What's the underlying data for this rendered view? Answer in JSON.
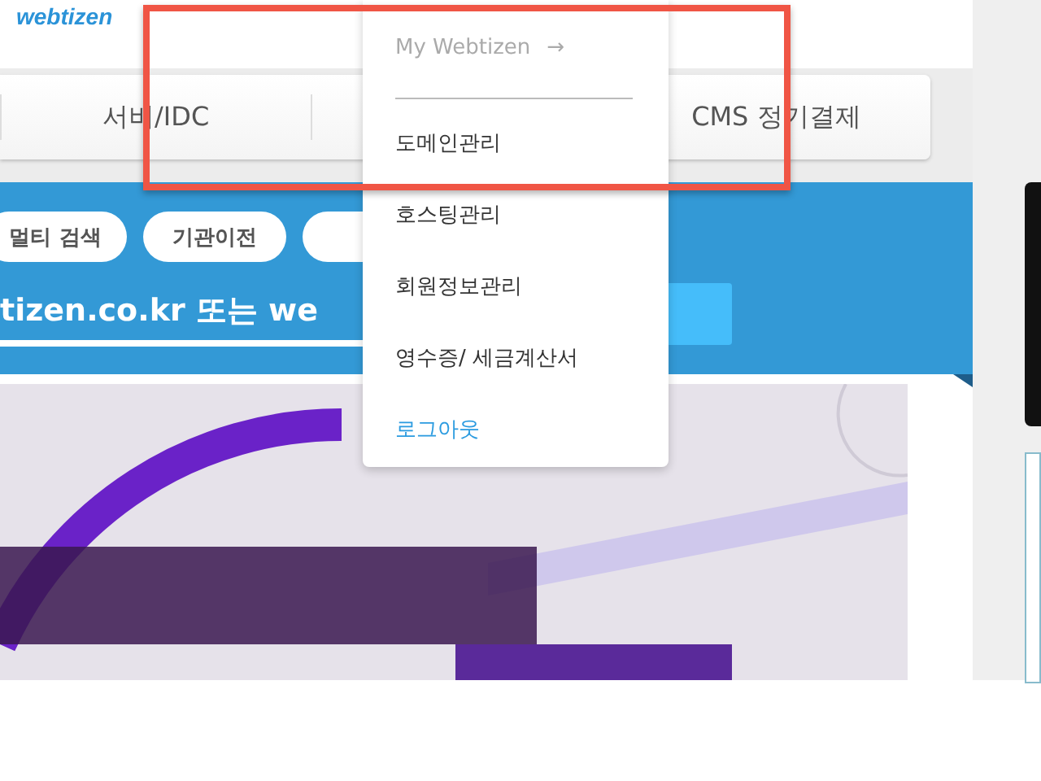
{
  "logo": "webtizen",
  "nav": {
    "items": [
      {
        "label": "서버/IDC"
      },
      {
        "label": "CMS 정기결제"
      }
    ]
  },
  "search_panel": {
    "quick_buttons": [
      "멀티 검색",
      "기관이전"
    ],
    "query_hint": "tizen.co.kr 또는 we"
  },
  "dropdown": {
    "header": "My Webtizen",
    "header_icon": "→",
    "items": [
      {
        "label": "도메인관리",
        "kind": "normal"
      },
      {
        "label": "호스팅관리",
        "kind": "normal"
      },
      {
        "label": "회원정보관리",
        "kind": "normal"
      },
      {
        "label": "영수증/ 세금계산서",
        "kind": "normal"
      },
      {
        "label": "로그아웃",
        "kind": "link"
      }
    ]
  },
  "annotation": {
    "highlight": true
  }
}
